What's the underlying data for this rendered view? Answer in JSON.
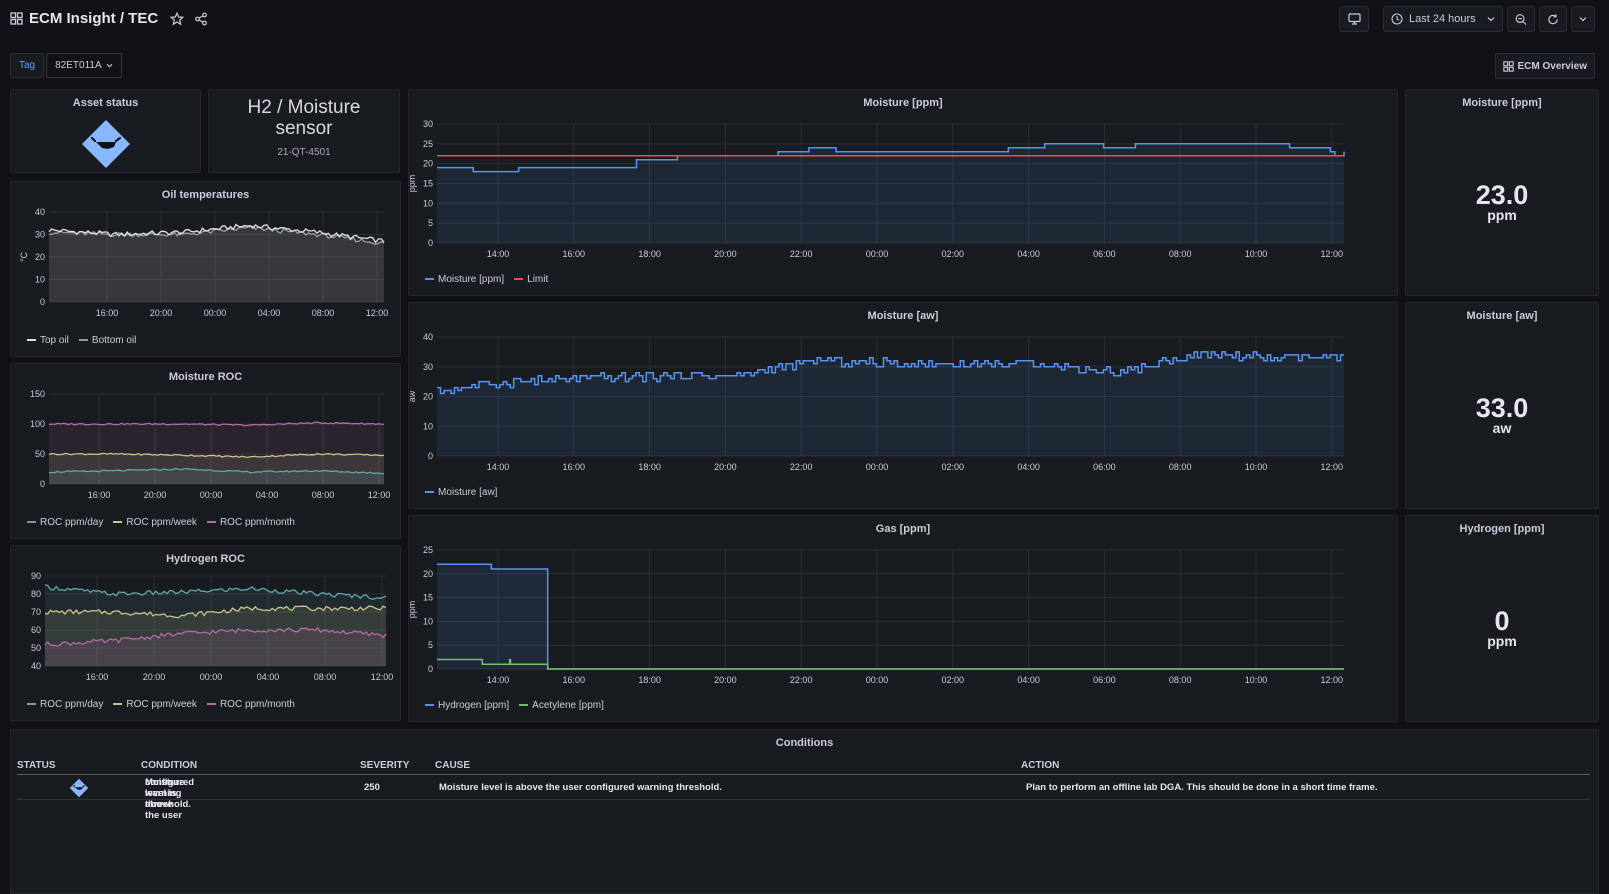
{
  "header": {
    "title": "ECM Insight / TEC",
    "time_range": "Last 24 hours"
  },
  "variables": {
    "tag_label": "Tag",
    "tag_value": "82ET011A"
  },
  "links": {
    "ecm_overview": "ECM Overview"
  },
  "asset_status": {
    "title": "Asset status",
    "icon": "warning-diamond-icon",
    "color": "#8ab8ff"
  },
  "sensor_panel": {
    "title": "H2 / Moisture sensor",
    "title_line1": "H2 / Moisture",
    "title_line2": "sensor",
    "id": "21-QT-4501"
  },
  "panels": {
    "oil_temps": {
      "title": "Oil temperatures",
      "ylabel": "°C",
      "yticks": [
        "40",
        "30",
        "20",
        "10",
        "0"
      ],
      "xticks": [
        "16:00",
        "20:00",
        "00:00",
        "04:00",
        "08:00",
        "12:00"
      ],
      "legend": [
        "Top oil",
        "Bottom oil"
      ]
    },
    "moisture_roc": {
      "title": "Moisture ROC",
      "yticks": [
        "150",
        "100",
        "50",
        "0"
      ],
      "xticks": [
        "16:00",
        "20:00",
        "00:00",
        "04:00",
        "08:00",
        "12:00"
      ],
      "legend": [
        "ROC ppm/day",
        "ROC ppm/week",
        "ROC ppm/month"
      ]
    },
    "hydrogen_roc": {
      "title": "Hydrogen ROC",
      "yticks": [
        "90",
        "80",
        "70",
        "60",
        "50",
        "40"
      ],
      "xticks": [
        "16:00",
        "20:00",
        "00:00",
        "04:00",
        "08:00",
        "12:00"
      ],
      "legend": [
        "ROC ppm/day",
        "ROC ppm/week",
        "ROC ppm/month"
      ]
    },
    "moisture_ppm": {
      "title": "Moisture [ppm]",
      "ylabel": "ppm",
      "yticks": [
        "30",
        "25",
        "20",
        "15",
        "10",
        "5",
        "0"
      ],
      "xticks": [
        "14:00",
        "16:00",
        "18:00",
        "20:00",
        "22:00",
        "00:00",
        "02:00",
        "04:00",
        "06:00",
        "08:00",
        "10:00",
        "12:00"
      ],
      "legend": [
        "Moisture [ppm]",
        "Limit"
      ]
    },
    "moisture_aw": {
      "title": "Moisture [aw]",
      "ylabel": "aw",
      "yticks": [
        "40",
        "30",
        "20",
        "10",
        "0"
      ],
      "xticks": [
        "14:00",
        "16:00",
        "18:00",
        "20:00",
        "22:00",
        "00:00",
        "02:00",
        "04:00",
        "06:00",
        "08:00",
        "10:00",
        "12:00"
      ],
      "legend": [
        "Moisture [aw]"
      ]
    },
    "gas_ppm": {
      "title": "Gas [ppm]",
      "ylabel": "ppm",
      "yticks": [
        "25",
        "20",
        "15",
        "10",
        "5",
        "0"
      ],
      "xticks": [
        "14:00",
        "16:00",
        "18:00",
        "20:00",
        "22:00",
        "00:00",
        "02:00",
        "04:00",
        "06:00",
        "08:00",
        "10:00",
        "12:00"
      ],
      "legend": [
        "Hydrogen [ppm]",
        "Acetylene [ppm]"
      ]
    }
  },
  "stats": {
    "moisture_ppm": {
      "title": "Moisture [ppm]",
      "value": "23.0",
      "unit": "ppm"
    },
    "moisture_aw": {
      "title": "Moisture [aw]",
      "value": "33.0",
      "unit": "aw"
    },
    "hydrogen_ppm": {
      "title": "Hydrogen [ppm]",
      "value": "0",
      "unit": "ppm"
    }
  },
  "conditions": {
    "title": "Conditions",
    "columns": [
      "STATUS",
      "CONDITION",
      "SEVERITY",
      "CAUSE",
      "ACTION"
    ],
    "rows": [
      {
        "status_icon": "warning-diamond-icon",
        "condition_line1": "Moisture level is above the user",
        "condition_line2": "configured warning threshold.",
        "severity": "250",
        "cause": "Moisture level is above the user configured warning threshold.",
        "action": "Plan to perform an offline lab DGA. This should be done in a short time frame."
      }
    ]
  },
  "colors": {
    "blue": "#5794f2",
    "red": "#f2495c",
    "green": "#73bf69",
    "white": "#e0e0e0",
    "teal": "#5fa8a8",
    "yellow": "#c9c48a",
    "pink": "#b76aa8"
  },
  "chart_data": [
    {
      "type": "line",
      "title": "Oil temperatures",
      "ylabel": "°C",
      "ylim": [
        0,
        40
      ],
      "x": [
        "16:00",
        "20:00",
        "00:00",
        "04:00",
        "08:00",
        "12:00"
      ],
      "series": [
        {
          "name": "Top oil",
          "values": [
            32,
            30,
            31,
            34,
            31,
            27
          ]
        },
        {
          "name": "Bottom oil",
          "values": [
            31,
            30,
            30,
            33,
            30,
            26
          ]
        }
      ]
    },
    {
      "type": "line",
      "title": "Moisture ROC",
      "ylim": [
        0,
        150
      ],
      "x": [
        "16:00",
        "20:00",
        "00:00",
        "04:00",
        "08:00",
        "12:00"
      ],
      "series": [
        {
          "name": "ROC ppm/day",
          "values": [
            20,
            22,
            25,
            20,
            22,
            18
          ]
        },
        {
          "name": "ROC ppm/week",
          "values": [
            50,
            50,
            48,
            45,
            50,
            48
          ]
        },
        {
          "name": "ROC ppm/month",
          "values": [
            100,
            100,
            100,
            98,
            102,
            100
          ]
        }
      ]
    },
    {
      "type": "line",
      "title": "Hydrogen ROC",
      "ylim": [
        40,
        90
      ],
      "x": [
        "16:00",
        "20:00",
        "00:00",
        "04:00",
        "08:00",
        "12:00"
      ],
      "series": [
        {
          "name": "ROC ppm/day",
          "values": [
            84,
            80,
            81,
            83,
            80,
            78
          ]
        },
        {
          "name": "ROC ppm/week",
          "values": [
            70,
            70,
            68,
            72,
            72,
            72
          ]
        },
        {
          "name": "ROC ppm/month",
          "values": [
            52,
            54,
            58,
            60,
            60,
            57
          ]
        }
      ]
    },
    {
      "type": "line",
      "title": "Moisture [ppm]",
      "ylabel": "ppm",
      "ylim": [
        0,
        30
      ],
      "x": [
        "12:30",
        "14:00",
        "16:00",
        "17:30",
        "19:00",
        "21:30",
        "23:00",
        "23:30",
        "02:30",
        "05:00",
        "08:00",
        "10:00",
        "12:00"
      ],
      "series": [
        {
          "name": "Moisture [ppm]",
          "values": [
            19,
            18,
            19,
            21,
            22,
            23,
            24,
            23,
            23,
            24,
            25,
            24,
            23
          ]
        },
        {
          "name": "Limit",
          "values": [
            22,
            22,
            22,
            22,
            22,
            22,
            22,
            22,
            22,
            22,
            22,
            22,
            22
          ]
        }
      ]
    },
    {
      "type": "line",
      "title": "Moisture [aw]",
      "ylabel": "aw",
      "ylim": [
        0,
        40
      ],
      "x": [
        "12:30",
        "14:00",
        "16:00",
        "18:00",
        "20:00",
        "22:00",
        "00:00",
        "02:00",
        "04:00",
        "06:00",
        "08:00",
        "10:00",
        "12:00"
      ],
      "series": [
        {
          "name": "Moisture [aw]",
          "values": [
            22,
            25,
            26,
            27,
            27,
            32,
            31,
            31,
            31,
            28,
            34,
            33,
            33
          ]
        }
      ]
    },
    {
      "type": "line",
      "title": "Gas [ppm]",
      "ylabel": "ppm",
      "ylim": [
        0,
        25
      ],
      "x": [
        "12:30",
        "14:00",
        "15:30",
        "16:00",
        "20:00",
        "00:00",
        "04:00",
        "08:00",
        "12:00"
      ],
      "series": [
        {
          "name": "Hydrogen [ppm]",
          "values": [
            22,
            21,
            21,
            0,
            0,
            0,
            0,
            0,
            0
          ]
        },
        {
          "name": "Acetylene [ppm]",
          "values": [
            2,
            1,
            1,
            0,
            0,
            0,
            0,
            0,
            0
          ]
        }
      ]
    }
  ]
}
